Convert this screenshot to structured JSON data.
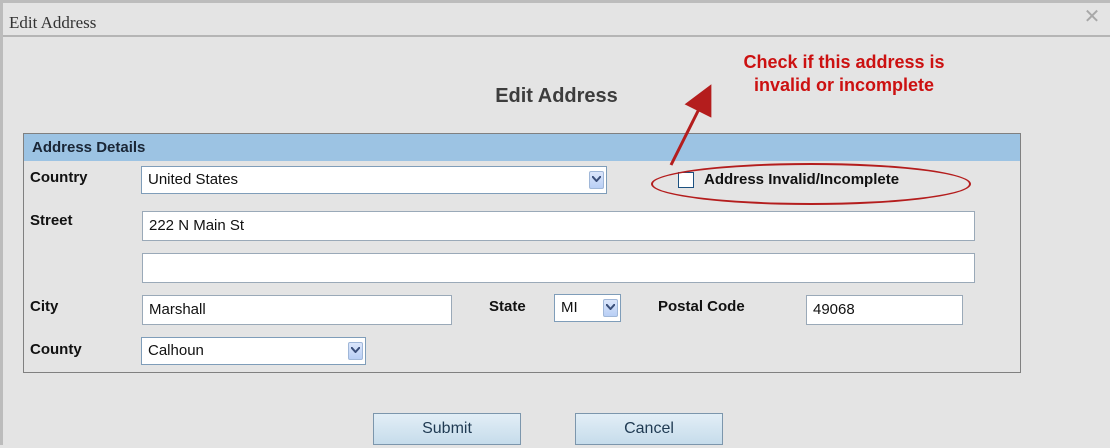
{
  "window": {
    "title": "Edit Address"
  },
  "form": {
    "heading": "Edit Address",
    "section_header": "Address Details",
    "country_label": "Country",
    "country_value": "United States",
    "invalid_label": "Address Invalid/Incomplete",
    "invalid_checked": false,
    "street_label": "Street",
    "street1_value": "222 N Main St",
    "street2_value": "",
    "city_label": "City",
    "city_value": "Marshall",
    "state_label": "State",
    "state_value": "MI",
    "postal_label": "Postal Code",
    "postal_value": "49068",
    "county_label": "County",
    "county_value": "Calhoun"
  },
  "buttons": {
    "submit": "Submit",
    "cancel": "Cancel"
  },
  "annotation": {
    "line1": "Check if this address is",
    "line2": "invalid or incomplete",
    "color": "#cc1111"
  },
  "icons": {
    "close": "close-icon",
    "dropdown": "chevron-down-icon"
  }
}
